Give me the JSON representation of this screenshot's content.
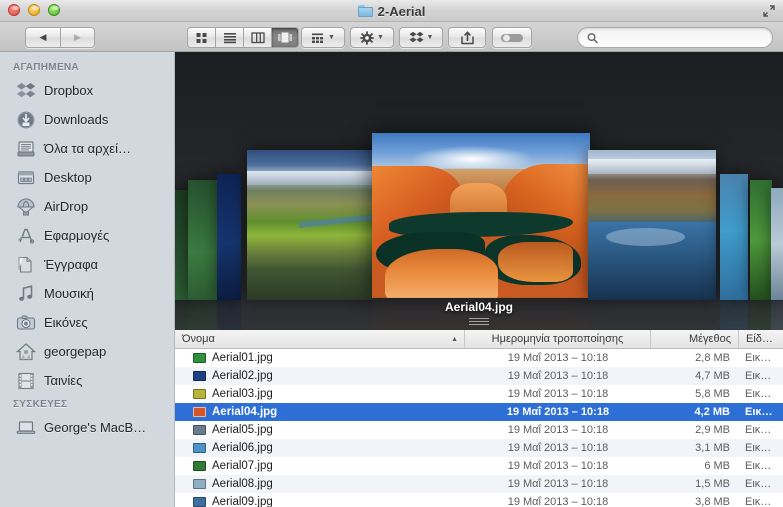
{
  "window": {
    "title": "2-Aerial",
    "folder_icon": "folder-icon",
    "fullscreen_icon": "fullscreen-icon",
    "traffic_lights": [
      "close-red",
      "minimize-yellow",
      "zoom-green"
    ]
  },
  "toolbar": {
    "back_label": "◀",
    "forward_label": "▶",
    "views": [
      {
        "name": "icon-view",
        "label": "Icon view",
        "active": false
      },
      {
        "name": "list-view",
        "label": "List view",
        "active": false
      },
      {
        "name": "column-view",
        "label": "Column view",
        "active": false
      },
      {
        "name": "coverflow-view",
        "label": "Cover Flow view",
        "active": true
      }
    ],
    "arrange_label": "arrange-icon",
    "action_label": "gear-icon",
    "dropbox_label": "dropbox-icon",
    "share_label": "share-icon",
    "tag_label": "tag-toggle",
    "caret": "▼"
  },
  "search": {
    "value": "",
    "placeholder": "",
    "icon": "search-icon"
  },
  "sidebar": {
    "sections": [
      {
        "header": "ΑΓΑΠΗΜΕΝΑ",
        "items": [
          {
            "label": "Dropbox",
            "icon": "dropbox-icon"
          },
          {
            "label": "Downloads",
            "icon": "downloads-icon"
          },
          {
            "label": "Όλα τα αρχεί…",
            "icon": "all-files-icon"
          },
          {
            "label": "Desktop",
            "icon": "desktop-icon"
          },
          {
            "label": "AirDrop",
            "icon": "airdrop-icon"
          },
          {
            "label": "Εφαρμογές",
            "icon": "applications-icon"
          },
          {
            "label": "Έγγραφα",
            "icon": "documents-icon"
          },
          {
            "label": "Μουσική",
            "icon": "music-icon"
          },
          {
            "label": "Εικόνες",
            "icon": "pictures-icon"
          },
          {
            "label": "georgepap",
            "icon": "home-icon"
          },
          {
            "label": "Ταινίες",
            "icon": "movies-icon"
          }
        ]
      },
      {
        "header": "ΣΥΣΚΕΥΕΣ",
        "items": [
          {
            "label": "George's MacB…",
            "icon": "laptop-icon"
          }
        ]
      }
    ]
  },
  "coverflow": {
    "selected_label": "Aerial04.jpg",
    "grip": "resize-grip",
    "background": "#26282c"
  },
  "list": {
    "columns": [
      {
        "key": "name",
        "label": "Όνομα",
        "sorted": true,
        "sort_arrow": "▲"
      },
      {
        "key": "date",
        "label": "Ημερομηνία τροποποίησης"
      },
      {
        "key": "size",
        "label": "Μέγεθος"
      },
      {
        "key": "kind",
        "label": "Είδ…"
      }
    ],
    "rows": [
      {
        "name": "Aerial01.jpg",
        "date": "19 Μαΐ 2013 – 10:18",
        "size": "2,8 MB",
        "kind": "Εικ…",
        "selected": false,
        "thumb": "#2e8f3c"
      },
      {
        "name": "Aerial02.jpg",
        "date": "19 Μαΐ 2013 – 10:18",
        "size": "4,7 MB",
        "kind": "Εικ…",
        "selected": false,
        "thumb": "#1d3f84"
      },
      {
        "name": "Aerial03.jpg",
        "date": "19 Μαΐ 2013 – 10:18",
        "size": "5,8 MB",
        "kind": "Εικ…",
        "selected": false,
        "thumb": "#b7b33c"
      },
      {
        "name": "Aerial04.jpg",
        "date": "19 Μαΐ 2013 – 10:18",
        "size": "4,2 MB",
        "kind": "Εικ…",
        "selected": true,
        "thumb": "#d4562a"
      },
      {
        "name": "Aerial05.jpg",
        "date": "19 Μαΐ 2013 – 10:18",
        "size": "2,9 MB",
        "kind": "Εικ…",
        "selected": false,
        "thumb": "#6a7d8c"
      },
      {
        "name": "Aerial06.jpg",
        "date": "19 Μαΐ 2013 – 10:18",
        "size": "3,1 MB",
        "kind": "Εικ…",
        "selected": false,
        "thumb": "#4b92c9"
      },
      {
        "name": "Aerial07.jpg",
        "date": "19 Μαΐ 2013 – 10:18",
        "size": "6 MB",
        "kind": "Εικ…",
        "selected": false,
        "thumb": "#2f7a35"
      },
      {
        "name": "Aerial08.jpg",
        "date": "19 Μαΐ 2013 – 10:18",
        "size": "1,5 MB",
        "kind": "Εικ…",
        "selected": false,
        "thumb": "#8fb0c4"
      },
      {
        "name": "Aerial09.jpg",
        "date": "19 Μαΐ 2013 – 10:18",
        "size": "3,8 MB",
        "kind": "Εικ…",
        "selected": false,
        "thumb": "#3d6fa0"
      }
    ]
  }
}
